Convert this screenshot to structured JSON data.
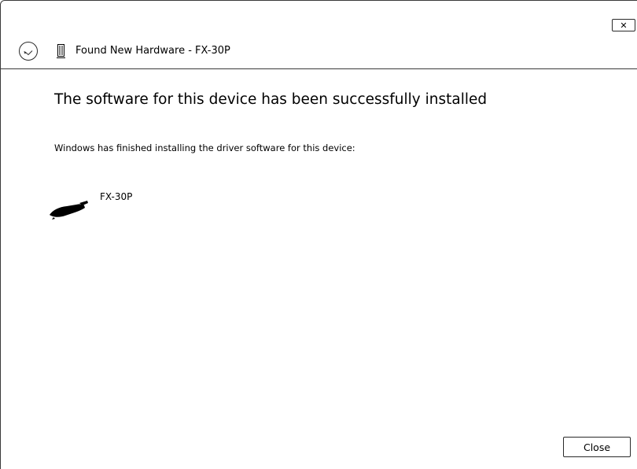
{
  "window": {
    "title": "Found New Hardware - FX-30P",
    "close_glyph": "✕"
  },
  "content": {
    "heading": "The software for this device has been successfully installed",
    "description": "Windows has finished installing the driver software for this device:",
    "device": {
      "name": "FX-30P",
      "icon": "device-connector-icon"
    }
  },
  "footer": {
    "close_label": "Close"
  },
  "icons": {
    "back": "back-arrow-icon",
    "title_device": "hardware-device-icon"
  },
  "colors": {
    "border": "#3a3a3a",
    "text": "#000000",
    "background": "#ffffff"
  }
}
